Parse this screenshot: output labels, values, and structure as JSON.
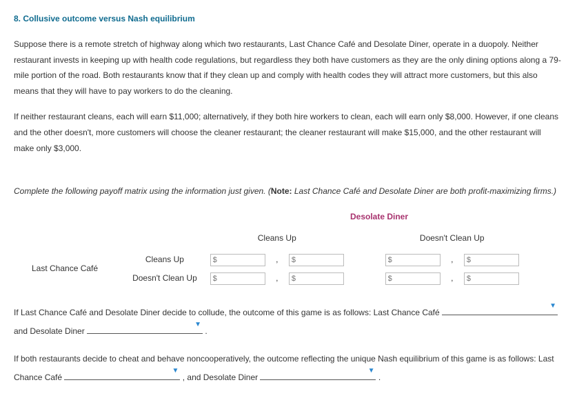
{
  "heading": "8. Collusive outcome versus Nash equilibrium",
  "para1": "Suppose there is a remote stretch of highway along which two restaurants, Last Chance Café and Desolate Diner, operate in a duopoly. Neither restaurant invests in keeping up with health code regulations, but regardless they both have customers as they are the only dining options along a 79-mile portion of the road. Both restaurants know that if they clean up and comply with health codes they will attract more customers, but this also means that they will have to pay workers to do the cleaning.",
  "para2": "If neither restaurant cleans, each will earn $11,000; alternatively, if they both hire workers to clean, each will earn only $8,000. However, if one cleans and the other doesn't, more customers will choose the cleaner restaurant; the cleaner restaurant will make $15,000, and the other restaurant will make only $3,000.",
  "instruction_pre": "Complete the following payoff matrix using the information just given. (",
  "instruction_note_label": "Note:",
  "instruction_note": " Last Chance Café and Desolate Diner are both profit-maximizing firms.)",
  "matrix": {
    "col_player": "Desolate Diner",
    "row_player": "Last Chance Café",
    "cols": {
      "c1": "Cleans Up",
      "c2": "Doesn't Clean Up"
    },
    "rows": {
      "r1": "Cleans Up",
      "r2": "Doesn't Clean Up"
    },
    "placeholder": "$"
  },
  "q1": {
    "t1": "If Last Chance Café and Desolate Diner decide to collude, the outcome of this game is as follows: Last Chance Café ",
    "t2": " and Desolate Diner ",
    "t3": " ."
  },
  "q2": {
    "t1": "If both restaurants decide to cheat and behave noncooperatively, the outcome reflecting the unique Nash equilibrium of this game is as follows: Last Chance Café ",
    "t2": " , and Desolate Diner ",
    "t3": " ."
  }
}
